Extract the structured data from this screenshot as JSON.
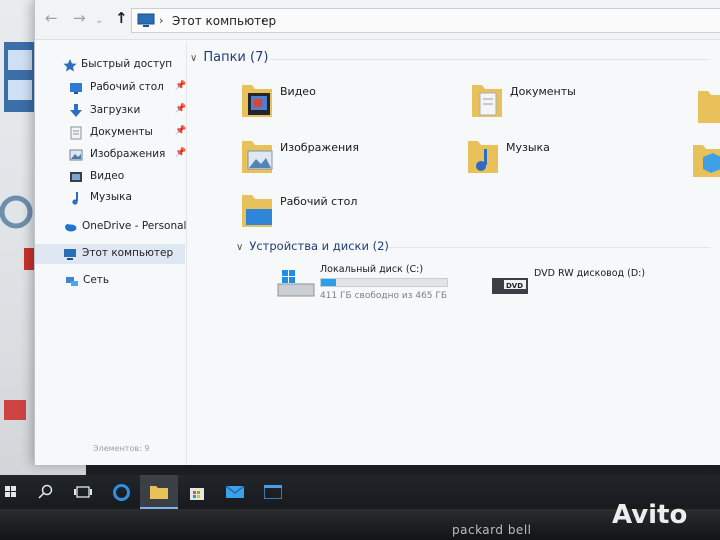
{
  "address": {
    "breadcrumb": "Этот компьютер",
    "separator": "›"
  },
  "nav": {
    "back": "←",
    "forward": "→",
    "dropdown": "⌄",
    "up": "↑",
    "pin": "📌",
    "items": [
      {
        "label": "Быстрый доступ",
        "icon": "star-icon"
      },
      {
        "label": "Рабочий стол",
        "icon": "desktop-icon"
      },
      {
        "label": "Загрузки",
        "icon": "download-icon"
      },
      {
        "label": "Документы",
        "icon": "documents-icon"
      },
      {
        "label": "Изображения",
        "icon": "pictures-icon"
      },
      {
        "label": "Видео",
        "icon": "video-icon"
      },
      {
        "label": "Музыка",
        "icon": "music-icon"
      },
      {
        "label": "OneDrive - Personal",
        "icon": "cloud-icon"
      },
      {
        "label": "Этот компьютер",
        "icon": "computer-icon"
      },
      {
        "label": "Сеть",
        "icon": "network-icon"
      }
    ]
  },
  "folders_group": {
    "title": "Папки (7)",
    "folders": [
      {
        "label": "Видео"
      },
      {
        "label": "Документы"
      },
      {
        "label": "Изображения"
      },
      {
        "label": "Музыка"
      },
      {
        "label": "Рабочий стол"
      }
    ]
  },
  "devices_group": {
    "title": "Устройства и диски (2)",
    "drives": [
      {
        "name": "Локальный диск (C:)",
        "free": "411 ГБ свободно из 465 ГБ",
        "used_fraction": 0.116
      },
      {
        "name": "DVD RW дисковод (D:)"
      }
    ],
    "dvd_badge": "DVD"
  },
  "status": {
    "text": "Элементов: 9"
  },
  "taskbar": {
    "brand": "packard bell"
  },
  "watermark": {
    "text": "Avito"
  },
  "colors": {
    "accent": "#29a0e8",
    "selected": "#dfe8f2",
    "group_header": "#1e3e7a"
  }
}
